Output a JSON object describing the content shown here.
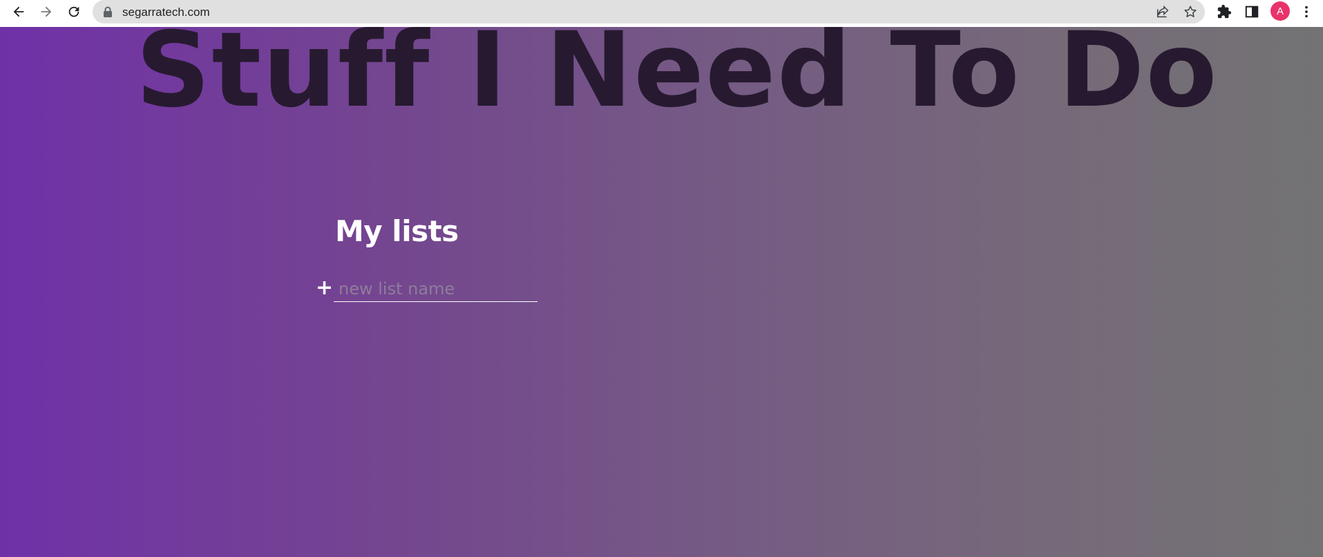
{
  "browser": {
    "url": "segarratech.com",
    "profile_initial": "A",
    "profile_color": "#e8336a",
    "icons": [
      "back-arrow-icon",
      "forward-arrow-icon",
      "reload-icon",
      "lock-icon",
      "share-icon",
      "star-icon",
      "extensions-icon",
      "side-panel-icon",
      "menu-dots-icon"
    ]
  },
  "page": {
    "title": "Stuff I Need To Do",
    "lists_heading": "My lists",
    "add_symbol": "+",
    "new_list_placeholder": "new list name",
    "new_list_value": "",
    "gradient_colors": [
      "#7031a8",
      "#74468f",
      "#755b84",
      "#76697a",
      "#737373"
    ],
    "title_color": "#271a30"
  }
}
